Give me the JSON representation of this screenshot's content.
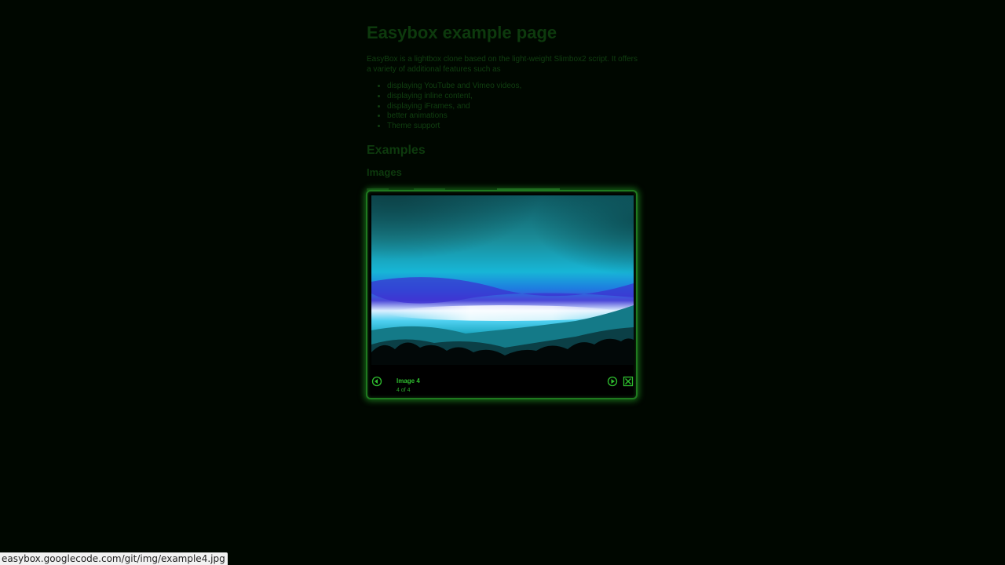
{
  "page": {
    "title": "Easybox example page",
    "intro": "EasyBox is a lightbox clone based on the light-weight Slimbox2 script. It offers a variety of additional features such as",
    "features": [
      "displaying YouTube and Vimeo videos,",
      "displaying inline content,",
      "displaying iFrames, and",
      "better animations",
      "Theme support"
    ],
    "examples_heading": "Examples",
    "images_heading": "Images"
  },
  "lightbox": {
    "caption": "Image 4",
    "number": "4 of 4",
    "prev_icon": "prev-arrow-icon",
    "play_icon": "play-icon",
    "close_icon": "close-x-icon"
  },
  "statusbar": {
    "url": "easybox.googlecode.com/git/img/example4.jpg"
  },
  "colors": {
    "background": "#000700",
    "lightbox_border": "#1f7a1f",
    "accent_green": "#2fbf2f",
    "dim_text": "#0f3d0f"
  }
}
